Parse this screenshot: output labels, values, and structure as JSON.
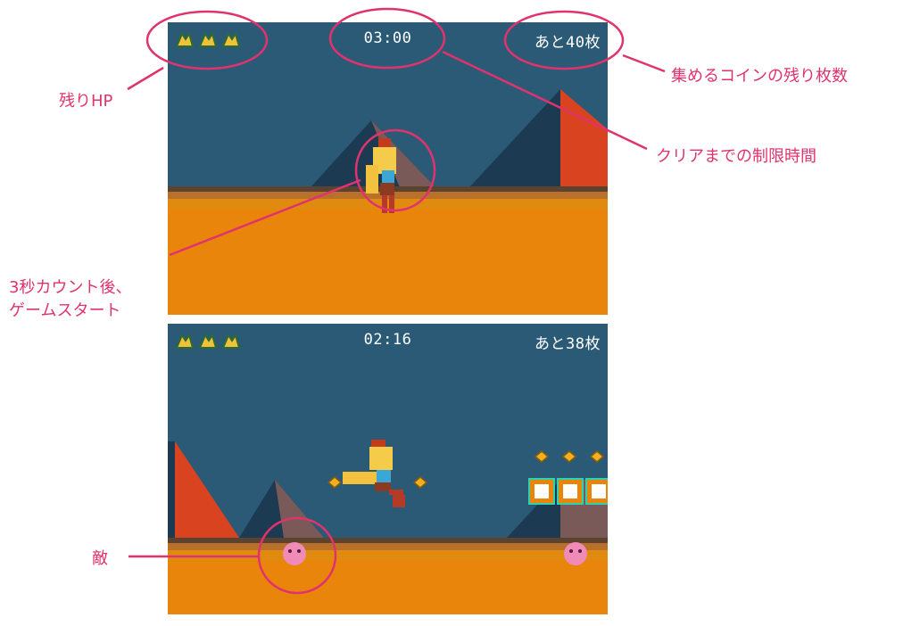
{
  "screen1": {
    "timer": "03:00",
    "coins_left": "あと40枚"
  },
  "screen2": {
    "timer": "02:16",
    "coins_left": "あと38枚"
  },
  "annotations": {
    "hp": "残りHP",
    "coins": "集めるコインの残り枚数",
    "time_limit": "クリアまでの制限時間",
    "start_line1": "3秒カウント後、",
    "start_line2": "ゲームスタート",
    "enemy": "敵"
  },
  "colors": {
    "annotation": "#e0336e",
    "sky": "#2b5a77",
    "ground": "#e8850a",
    "pyramid_light": "#d9431f",
    "pyramid_dark": "#1c3b53"
  },
  "hp_icon": "heart-icon"
}
